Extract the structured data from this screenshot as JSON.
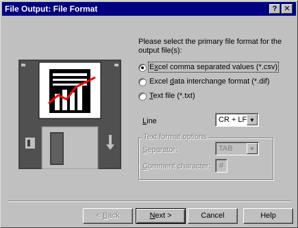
{
  "window": {
    "title": "File Output: File Format",
    "help_button": "?",
    "close_button": "✕"
  },
  "prompt": {
    "line1": "Please select the primary file format for the",
    "line2": "output file(s):"
  },
  "formats": [
    {
      "pre": "E",
      "accel": "x",
      "post": "cel comma separated values (*.csv)",
      "selected": true
    },
    {
      "pre": "Excel ",
      "accel": "d",
      "post": "ata interchange format (*.dif)",
      "selected": false
    },
    {
      "pre": "",
      "accel": "T",
      "post": "ext file (*.txt)",
      "selected": false
    }
  ],
  "line": {
    "accel": "L",
    "rest": "ine",
    "value": "CR + LF"
  },
  "text_options": {
    "title": "Text format options",
    "separator_accel": "S",
    "separator_rest": "eparator:",
    "separator_value": "TAB",
    "comment_accel": "C",
    "comment_rest": "omment character:",
    "comment_value": "#"
  },
  "buttons": {
    "back_pre": "< ",
    "back_accel": "B",
    "back_rest": "ack",
    "next_accel": "N",
    "next_rest": "ext >",
    "cancel": "Cancel",
    "help": "Help"
  },
  "icons": {
    "illustration": "floppy-disk-chart-icon",
    "arrow_down": "▼"
  }
}
